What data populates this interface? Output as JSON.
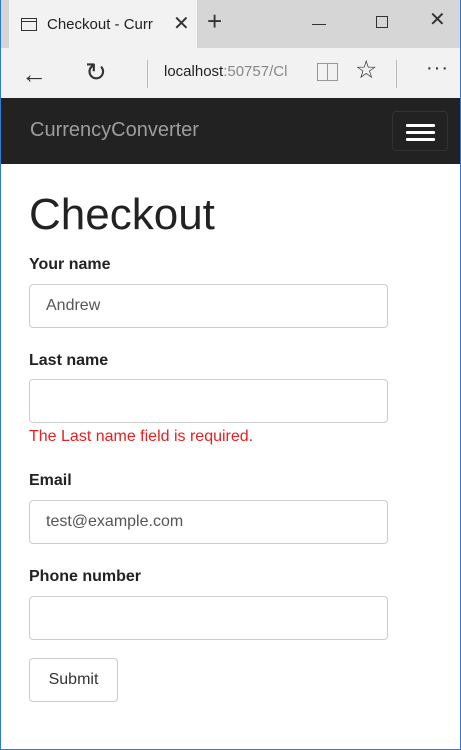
{
  "browser": {
    "tab_title": "Checkout - Curr",
    "tab_close": "✕",
    "new_tab": "+",
    "min_icon": "minimize-icon",
    "max_icon": "maximize-icon",
    "close": "✕",
    "back": "←",
    "refresh": "↻",
    "url_host": "localhost",
    "url_rest": ":50757/Cl",
    "favorite": "☆",
    "more": "···"
  },
  "navbar": {
    "brand": "CurrencyConverter"
  },
  "page": {
    "title": "Checkout"
  },
  "form": {
    "first_name": {
      "label": "Your name",
      "value": "Andrew"
    },
    "last_name": {
      "label": "Last name",
      "value": "",
      "error": "The Last name field is required."
    },
    "email": {
      "label": "Email",
      "value": "test@example.com"
    },
    "phone": {
      "label": "Phone number",
      "value": ""
    },
    "submit_label": "Submit"
  },
  "colors": {
    "navbar_bg": "#222222",
    "brand": "#9d9d9d",
    "error": "#e62020",
    "window_border": "#2a7ad6"
  }
}
